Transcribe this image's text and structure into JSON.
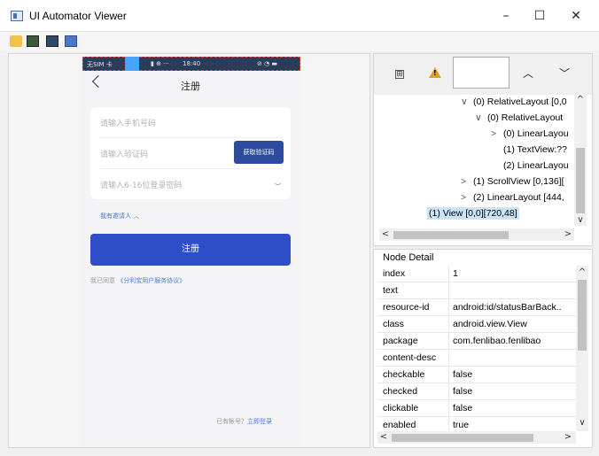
{
  "window": {
    "title": "UI Automator Viewer",
    "minimize": "–",
    "maximize": "☐",
    "close": "✕"
  },
  "toolbar": {
    "icons": [
      "open-folder-icon",
      "device-screenshot-icon",
      "device-screenshot-compressed-icon",
      "save-icon"
    ]
  },
  "device": {
    "statusbar": {
      "carrier": "无SIM 卡",
      "icons": "▮ ⊕ ···",
      "time": "18:40",
      "right": "⊘ ◔ ▬"
    },
    "page_title": "注册",
    "back_symbol": "<",
    "fields": {
      "phone_placeholder": "请输入手机号码",
      "code_placeholder": "请输入验证码",
      "password_placeholder": "请输入6-16位登录密码"
    },
    "get_code_button": "获取验证码",
    "invite_text": "我有邀请人 ︿",
    "register_button": "注册",
    "agree_prefix": "我已同意",
    "agree_link": "《分利宝用户服务协议》",
    "login_prefix": "已有帐号？",
    "login_link": "立即登录"
  },
  "tree_toolbar": {
    "expand_symbol": "⊞",
    "warn_symbol": "!",
    "up": "︿",
    "down": "﹀"
  },
  "tree": {
    "rows": [
      {
        "arrow": "∨",
        "text": "(0) RelativeLayout [0,0"
      },
      {
        "arrow": "∨",
        "text": "(0) RelativeLayout"
      },
      {
        "arrow": ">",
        "text": "(0) LinearLayou"
      },
      {
        "arrow": "",
        "text": "(1) TextView:??"
      },
      {
        "arrow": "",
        "text": "(2) LinearLayou"
      },
      {
        "arrow": ">",
        "text": "(1) ScrollView [0,136]["
      },
      {
        "arrow": ">",
        "text": "(2) LinearLayout [444,"
      },
      {
        "arrow": "",
        "text": "(1) View [0,0][720,48]"
      }
    ],
    "scroll_left": "<",
    "scroll_right": ">",
    "scroll_up": "^",
    "scroll_down": "∨"
  },
  "node_detail": {
    "title": "Node Detail",
    "rows": [
      {
        "key": "index",
        "value": "1"
      },
      {
        "key": "text",
        "value": ""
      },
      {
        "key": "resource-id",
        "value": "android:id/statusBarBack.."
      },
      {
        "key": "class",
        "value": "android.view.View"
      },
      {
        "key": "package",
        "value": "com.fenlibao.fenlibao"
      },
      {
        "key": "content-desc",
        "value": ""
      },
      {
        "key": "checkable",
        "value": "false"
      },
      {
        "key": "checked",
        "value": "false"
      },
      {
        "key": "clickable",
        "value": "false"
      },
      {
        "key": "enabled",
        "value": "true"
      }
    ],
    "scroll_up": "^",
    "scroll_down": "∨",
    "scroll_left": "<",
    "scroll_right": ">"
  },
  "colors": {
    "primary_button": "#2e4ec8",
    "code_button": "#2e4a9e",
    "selection": "#cce4f7",
    "statusbar_bg": "#2b3c5a"
  }
}
